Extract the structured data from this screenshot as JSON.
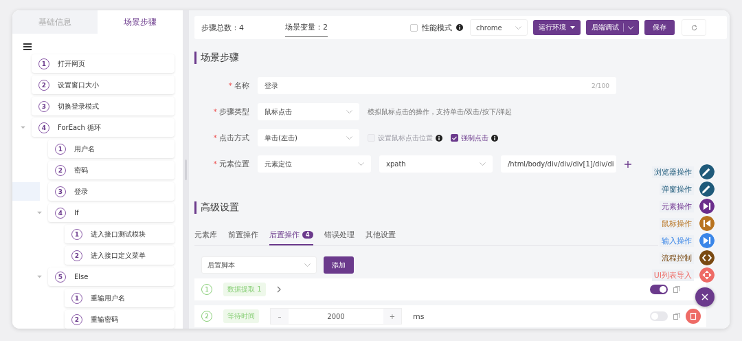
{
  "left_tabs": [
    {
      "label": "基础信息",
      "selected": false
    },
    {
      "label": "场景步骤",
      "selected": true
    }
  ],
  "steps_tree": [
    {
      "number": "1",
      "label": "打开网页",
      "selected": false
    },
    {
      "number": "2",
      "label": "设置窗口大小",
      "selected": false
    },
    {
      "number": "3",
      "label": "切换登录模式",
      "selected": false
    },
    {
      "number": "4",
      "label": "ForEach 循环",
      "selected": false,
      "expanded": true,
      "children": [
        {
          "number": "1",
          "label": "用户名",
          "selected": false
        },
        {
          "number": "2",
          "label": "密码",
          "selected": false
        },
        {
          "number": "3",
          "label": "登录",
          "selected": true
        },
        {
          "number": "4",
          "label": "If",
          "selected": false,
          "expanded": true,
          "children": [
            {
              "number": "1",
              "label": "进入接口测试模块",
              "selected": false
            },
            {
              "number": "2",
              "label": "进入接口定义菜单",
              "selected": false
            }
          ]
        },
        {
          "number": "5",
          "label": "Else",
          "selected": false,
          "expanded": true,
          "children": [
            {
              "number": "1",
              "label": "重输用户名",
              "selected": false
            },
            {
              "number": "2",
              "label": "重输密码",
              "selected": false
            }
          ]
        }
      ]
    }
  ],
  "toolbar": {
    "stats": [
      {
        "label": "步骤总数：4",
        "selected": false
      },
      {
        "label": "场景变量：2",
        "selected": true
      }
    ],
    "perf_mode": {
      "label": "性能模式",
      "checked": false
    },
    "browser": "chrome",
    "buttons": [
      {
        "label": "运行环境",
        "kind": "dropdown"
      },
      {
        "label": "后端调试",
        "kind": "split"
      },
      {
        "label": "保存",
        "kind": "plain"
      },
      {
        "kind": "refresh"
      }
    ]
  },
  "section_title": "场景步骤",
  "form": {
    "name": {
      "label": "名称",
      "required_mark": "*",
      "value": "登录",
      "count": "2/100"
    },
    "step_type": {
      "label": "步骤类型",
      "required_mark": "*",
      "value": "鼠标点击",
      "hint": "模拟鼠标点击的操作，支持单击/双击/按下/弹起"
    },
    "click_mode": {
      "label": "点击方式",
      "required_mark": "*",
      "value": "单击(左击)",
      "options": [
        {
          "label": "设置鼠标点击位置",
          "checked": false,
          "disabled": true
        },
        {
          "label": "强制点击",
          "checked": true,
          "disabled": false
        }
      ]
    },
    "locator": {
      "label": "元素位置",
      "required_mark": "*",
      "strategy": "元素定位",
      "by": "xpath",
      "value": "/html/body/div/div/div[1]/div/di"
    }
  },
  "advanced_title": "高级设置",
  "advanced_tabs": [
    {
      "label": "元素库",
      "selected": false
    },
    {
      "label": "前置操作",
      "selected": false
    },
    {
      "label": "后置操作",
      "selected": true,
      "badge": "4"
    },
    {
      "label": "错误处理",
      "selected": false
    },
    {
      "label": "其他设置",
      "selected": false
    }
  ],
  "script_select": "后置脚本",
  "add_button": "添加",
  "post_steps": [
    {
      "kind": "extract",
      "number": "1",
      "tag": "数据提取 1",
      "enabled": true
    },
    {
      "kind": "wait",
      "number": "2",
      "tag": "等待时间",
      "decrement": "–",
      "value": "2000",
      "increment": "+",
      "unit": "ms",
      "enabled": false
    }
  ],
  "float_menu": [
    {
      "label": "浏览器操作",
      "color": "#1f5a7a",
      "kind": "pen"
    },
    {
      "label": "弹窗操作",
      "color": "#1f5a7a",
      "kind": "pen"
    },
    {
      "label": "元素操作",
      "color": "#6b2d8c",
      "kind": "skip"
    },
    {
      "label": "鼠标操作",
      "color": "#b8731f",
      "kind": "back"
    },
    {
      "label": "输入操作",
      "color": "#3a86e8",
      "kind": "skip"
    },
    {
      "label": "流程控制",
      "color": "#7a4a12",
      "kind": "code"
    },
    {
      "label": "UI列表导入",
      "color": "#ee6b66",
      "kind": "move"
    }
  ]
}
